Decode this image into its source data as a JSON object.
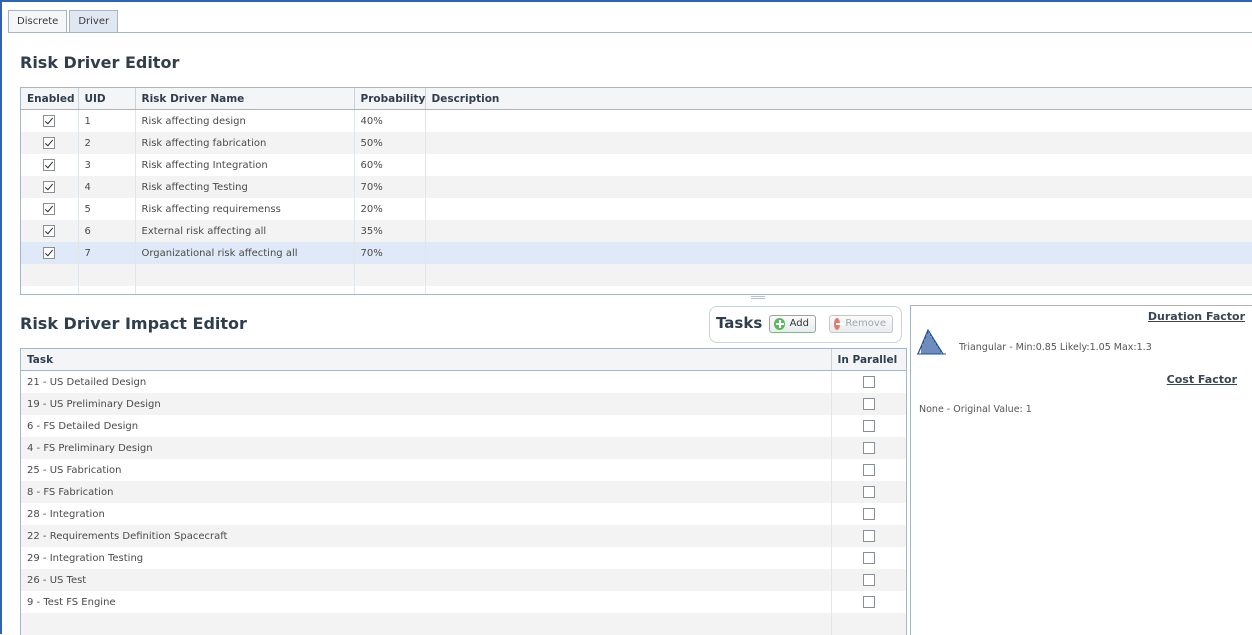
{
  "tabs": [
    {
      "label": "Discrete"
    },
    {
      "label": "Driver"
    }
  ],
  "driver_editor": {
    "title": "Risk Driver Editor",
    "columns": [
      "Enabled",
      "UID",
      "Risk Driver Name",
      "Probability",
      "Description"
    ],
    "rows": [
      {
        "enabled": true,
        "uid": "1",
        "name": "Risk affecting design",
        "probability": "40%",
        "description": ""
      },
      {
        "enabled": true,
        "uid": "2",
        "name": "Risk affecting fabrication",
        "probability": "50%",
        "description": ""
      },
      {
        "enabled": true,
        "uid": "3",
        "name": "Risk affecting Integration",
        "probability": "60%",
        "description": ""
      },
      {
        "enabled": true,
        "uid": "4",
        "name": "Risk affecting Testing",
        "probability": "70%",
        "description": ""
      },
      {
        "enabled": true,
        "uid": "5",
        "name": "Risk affecting requiremenss",
        "probability": "20%",
        "description": ""
      },
      {
        "enabled": true,
        "uid": "6",
        "name": "External risk affecting all",
        "probability": "35%",
        "description": ""
      },
      {
        "enabled": true,
        "uid": "7",
        "name": "Organizational risk affecting all",
        "probability": "70%",
        "description": ""
      }
    ]
  },
  "impact_editor": {
    "title": "Risk Driver Impact Editor",
    "toolbar": {
      "label": "Tasks",
      "add_label": "Add",
      "remove_label": "Remove"
    },
    "columns": [
      "Task",
      "In Parallel"
    ],
    "rows": [
      {
        "task": "21 - US  Detailed Design",
        "parallel": false
      },
      {
        "task": "19 - US Preliminary Design",
        "parallel": false
      },
      {
        "task": "6 - FS Detailed Design",
        "parallel": false
      },
      {
        "task": "4 - FS Preliminary Design",
        "parallel": false
      },
      {
        "task": "25 - US Fabrication",
        "parallel": false
      },
      {
        "task": "8 - FS Fabrication",
        "parallel": false
      },
      {
        "task": "28 - Integration",
        "parallel": false
      },
      {
        "task": "22 - Requirements Definition Spacecraft",
        "parallel": false
      },
      {
        "task": "29 - Integration Testing",
        "parallel": false
      },
      {
        "task": "26 - US Test",
        "parallel": false
      },
      {
        "task": "9 - Test FS Engine",
        "parallel": false
      }
    ]
  },
  "factors": {
    "duration_label": "Duration Factor",
    "duration_value": "Triangular - Min:0.85 Likely:1.05 Max:1.3",
    "cost_label": "Cost Factor",
    "cost_value": "None - Original Value: 1"
  }
}
